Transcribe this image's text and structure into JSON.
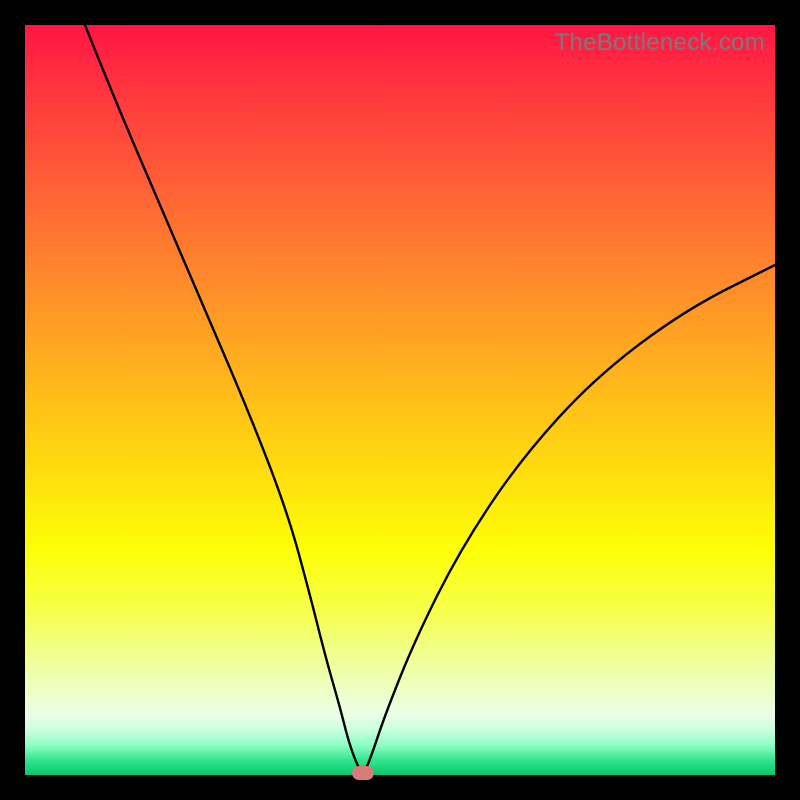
{
  "watermark": "TheBottleneck.com",
  "chart_data": {
    "type": "line",
    "title": "",
    "xlabel": "",
    "ylabel": "",
    "xlim": [
      0,
      100
    ],
    "ylim": [
      0,
      100
    ],
    "grid": false,
    "series": [
      {
        "name": "curve",
        "x": [
          8,
          12,
          18,
          24,
          30,
          35,
          38,
          40,
          42,
          43,
          44,
          45,
          46,
          48,
          52,
          58,
          66,
          76,
          88,
          100
        ],
        "values": [
          100,
          90,
          76,
          62,
          48,
          35,
          24,
          16,
          9,
          5,
          2,
          0,
          2,
          8,
          18,
          30,
          42,
          53,
          62,
          68
        ]
      }
    ],
    "marker": {
      "x": 45,
      "y": 0
    },
    "background_gradient": {
      "top": "#ff1643",
      "mid": "#ffe100",
      "bottom": "#06c66b"
    },
    "frame_color": "#000000"
  }
}
